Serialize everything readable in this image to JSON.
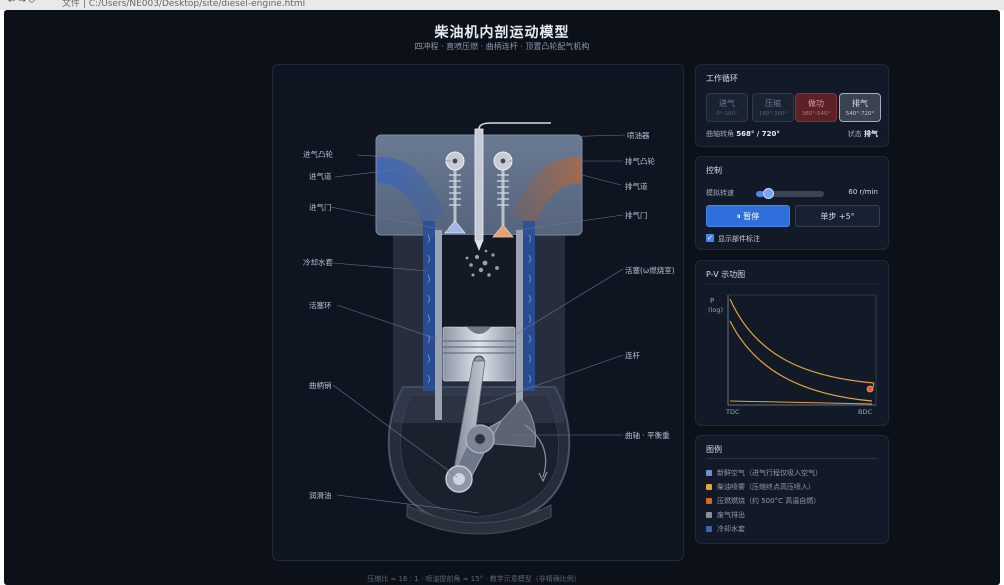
{
  "browser": {
    "url": "文件 | C:/Users/NE003/Desktop/site/diesel-engine.html"
  },
  "header": {
    "title": "柴油机内剖运动模型",
    "subtitle": "四冲程 · 直喷压燃 · 曲柄连杆 · 顶置凸轮配气机构"
  },
  "labels": {
    "left": [
      "进气凸轮",
      "进气道",
      "进气门",
      "冷却水套",
      "活塞环",
      "曲柄销",
      "润滑油"
    ],
    "right": [
      "喷油器",
      "排气凸轮",
      "排气道",
      "排气门",
      "活塞(ω燃烧室)",
      "连杆",
      "曲轴 · 平衡重"
    ]
  },
  "cycle": {
    "title": "工作循环",
    "strokes": [
      {
        "name": "进气",
        "range": "0°-180°",
        "state": "inactive"
      },
      {
        "name": "压缩",
        "range": "180°-360°",
        "state": "inactive"
      },
      {
        "name": "做功",
        "range": "360°-540°",
        "state": "power"
      },
      {
        "name": "排气",
        "range": "540°-720°",
        "state": "active"
      }
    ],
    "crank_label": "曲轴转角",
    "crank_value": "568° / 720°",
    "crank_deg": 568,
    "status_label": "状态",
    "status_value": "排气"
  },
  "control": {
    "title": "控制",
    "speed_label": "模拟转速",
    "speed_value": "60 r/min",
    "speed_fraction": 0.12,
    "pause_label": "⏸ 暂停",
    "step_label": "单步 +5°",
    "show_labels_label": "显示部件标注",
    "show_labels_checked": true
  },
  "pv": {
    "title": "P-V 示功图",
    "y_label": "P",
    "y_sub": "(log)",
    "x_left": "TDC",
    "x_right": "BDC"
  },
  "legend": {
    "title": "图例",
    "items": [
      {
        "text": "新鲜空气（进气行程仅吸入空气）",
        "color": "#6b8fd6"
      },
      {
        "text": "柴油喷雾（压缩终点高压喷入）",
        "color": "#e6a23c"
      },
      {
        "text": "压燃燃烧（约 500°C 高温自燃）",
        "color": "#e0632c"
      },
      {
        "text": "废气排出",
        "color": "#8a8f98"
      },
      {
        "text": "冷却水套",
        "color": "#3b64b8"
      }
    ]
  },
  "footer": {
    "note": "压缩比 ≈ 16 : 1 · 喷油提前角 ≈ 15° · 教学示意模型（非精确比例）"
  },
  "colors": {
    "background": "#0b1019",
    "panel": "#121a27",
    "accent": "#2f6fdb",
    "power": "#5a2226",
    "exhaust": "#c0703c",
    "intake": "#3b64b8"
  }
}
